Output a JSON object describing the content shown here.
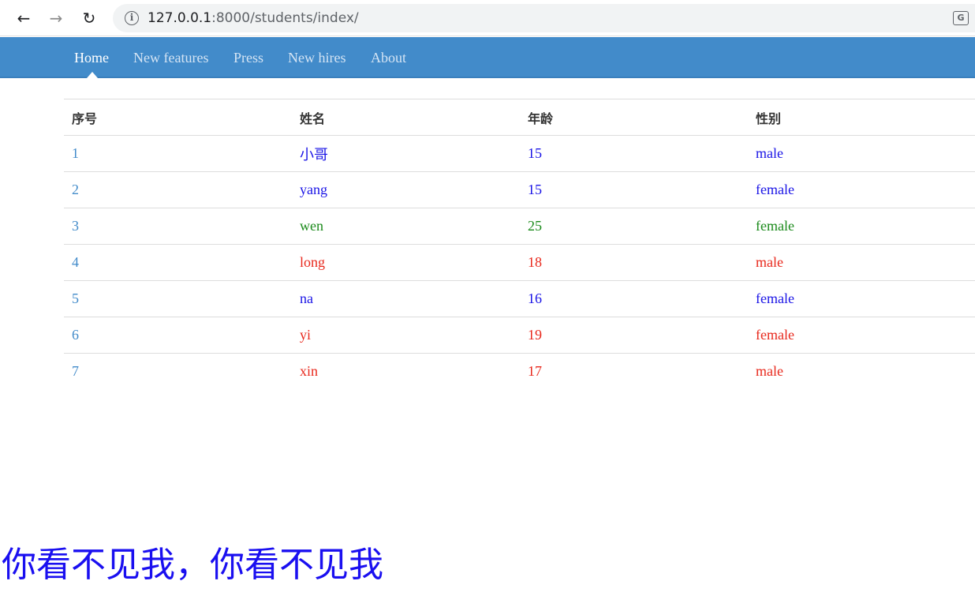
{
  "browser": {
    "back_icon": "arrow-left-icon",
    "forward_icon": "arrow-right-icon",
    "reload_icon": "reload-icon",
    "url_host": "127.0.0.1",
    "url_rest": ":8000/students/index/"
  },
  "navbar": {
    "color": "#428bca",
    "items": [
      {
        "label": "Home",
        "active": true
      },
      {
        "label": "New features",
        "active": false
      },
      {
        "label": "Press",
        "active": false
      },
      {
        "label": "New hires",
        "active": false
      },
      {
        "label": "About",
        "active": false
      }
    ]
  },
  "table": {
    "headers": [
      "序号",
      "姓名",
      "年龄",
      "性别"
    ],
    "rows": [
      {
        "index": "1",
        "name": "小哥",
        "age": "15",
        "gender": "male",
        "color": "#1a14e6"
      },
      {
        "index": "2",
        "name": "yang",
        "age": "15",
        "gender": "female",
        "color": "#1a14e6"
      },
      {
        "index": "3",
        "name": "wen",
        "age": "25",
        "gender": "female",
        "color": "#1a8a1a"
      },
      {
        "index": "4",
        "name": "long",
        "age": "18",
        "gender": "male",
        "color": "#e8281c"
      },
      {
        "index": "5",
        "name": "na",
        "age": "16",
        "gender": "female",
        "color": "#1a14e6"
      },
      {
        "index": "6",
        "name": "yi",
        "age": "19",
        "gender": "female",
        "color": "#e8281c"
      },
      {
        "index": "7",
        "name": "xin",
        "age": "17",
        "gender": "male",
        "color": "#e8281c"
      }
    ]
  },
  "footer": {
    "text": "你看不见我，你看不见我",
    "color": "#1a0ff0"
  }
}
